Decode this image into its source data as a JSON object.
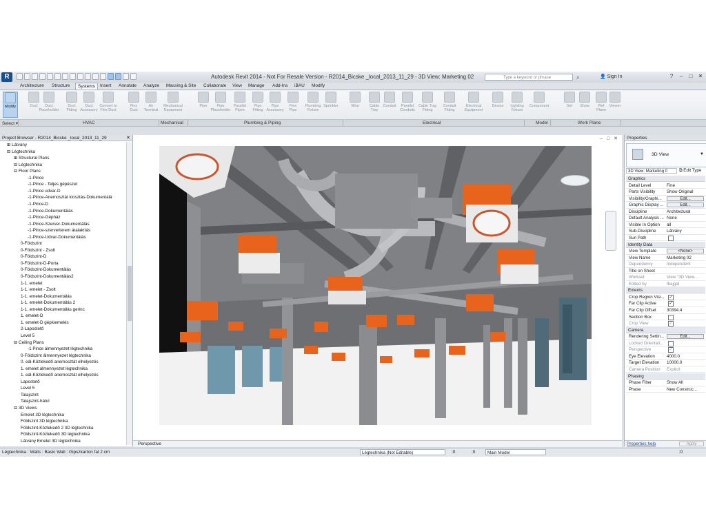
{
  "window": {
    "title": "Autodesk Revit 2014 - Not For Resale Version -    R2014_Bicske _local_2013_11_29 - 3D View: Marketing 02",
    "search_placeholder": "Type a keyword or phrase",
    "sign_in": "Sign In"
  },
  "tabs": [
    "Architecture",
    "Structure",
    "Systems",
    "Insert",
    "Annotate",
    "Analyze",
    "Massing & Site",
    "Collaborate",
    "View",
    "Manage",
    "Add-Ins",
    "iBAU",
    "Modify"
  ],
  "active_tab": "Systems",
  "ribbon": {
    "buttons": [
      {
        "label": "Modify",
        "l2": ""
      },
      {
        "label": "Duct",
        "l2": ""
      },
      {
        "label": "Duct",
        "l2": "Placeholder"
      },
      {
        "label": "Duct",
        "l2": "Fitting"
      },
      {
        "label": "Duct",
        "l2": "Accessory"
      },
      {
        "label": "Convert to",
        "l2": "Flex Duct"
      },
      {
        "label": "Flex",
        "l2": "Duct"
      },
      {
        "label": "Air",
        "l2": "Terminal"
      },
      {
        "label": "Mechanical",
        "l2": "Equipment"
      },
      {
        "label": "Pipe",
        "l2": ""
      },
      {
        "label": "Pipe",
        "l2": "Placeholder"
      },
      {
        "label": "Parallel",
        "l2": "Pipes"
      },
      {
        "label": "Pipe",
        "l2": "Fitting"
      },
      {
        "label": "Pipe",
        "l2": "Accessory"
      },
      {
        "label": "Flex",
        "l2": "Pipe"
      },
      {
        "label": "Plumbing",
        "l2": "Fixture"
      },
      {
        "label": "Sprinkler",
        "l2": ""
      },
      {
        "label": "Wire",
        "l2": ""
      },
      {
        "label": "Cable",
        "l2": "Tray"
      },
      {
        "label": "Conduit",
        "l2": ""
      },
      {
        "label": "Parallel",
        "l2": "Conduits"
      },
      {
        "label": "Cable Tray",
        "l2": "Fitting"
      },
      {
        "label": "Conduit",
        "l2": "Fitting"
      },
      {
        "label": "Electrical",
        "l2": "Equipment"
      },
      {
        "label": "Device",
        "l2": ""
      },
      {
        "label": "Lighting",
        "l2": "Fixture"
      },
      {
        "label": "Component",
        "l2": ""
      },
      {
        "label": "Set",
        "l2": ""
      },
      {
        "label": "Show",
        "l2": ""
      },
      {
        "label": "Ref",
        "l2": "Plane"
      },
      {
        "label": "Viewer",
        "l2": ""
      }
    ],
    "panels": [
      "Select ▾",
      "HVAC",
      "Mechanical",
      "Plumbing & Piping",
      "Electrical",
      "Model",
      "Work Plane"
    ]
  },
  "project_browser": {
    "title": "Project Browser - R2014_Bicske _local_2013_11_29",
    "items": [
      {
        "t": "Látvány",
        "d": 2,
        "e": "+"
      },
      {
        "t": "Légtechnika",
        "d": 2,
        "e": "-"
      },
      {
        "t": "Structural Plans",
        "d": 3,
        "e": "+"
      },
      {
        "t": "Légtechnika",
        "d": 3,
        "e": "-"
      },
      {
        "t": "Floor Plans",
        "d": 3,
        "e": "-"
      },
      {
        "t": "-1-Pince",
        "d": 5,
        "e": ""
      },
      {
        "t": "-1-Pince - Teljes gépészet",
        "d": 5,
        "e": ""
      },
      {
        "t": "-1-Pince udvar-D",
        "d": 5,
        "e": ""
      },
      {
        "t": "-1-Pince-Anemosztát kiosztás-Dokumentálá",
        "d": 5,
        "e": ""
      },
      {
        "t": "-1-Pince-D",
        "d": 5,
        "e": ""
      },
      {
        "t": "-1-Pince-Dokumentálás",
        "d": 5,
        "e": ""
      },
      {
        "t": "-1-Pince-Gépház",
        "d": 5,
        "e": ""
      },
      {
        "t": "-1-Pince-Szerver-Dokumentálás",
        "d": 5,
        "e": ""
      },
      {
        "t": "-1-Pince-szerverterem átalakítás",
        "d": 5,
        "e": ""
      },
      {
        "t": "-1-Pince-Udvar-Dokumentálás",
        "d": 5,
        "e": ""
      },
      {
        "t": "0-Földszint",
        "d": 4,
        "e": ""
      },
      {
        "t": "0-Földszint - Zsolt",
        "d": 4,
        "e": ""
      },
      {
        "t": "0-Földszint-D",
        "d": 4,
        "e": ""
      },
      {
        "t": "0-Földszint-D-Porta",
        "d": 4,
        "e": ""
      },
      {
        "t": "0-Földszint-Dokumentálás",
        "d": 4,
        "e": ""
      },
      {
        "t": "0-Földszint-Dokumentálás2",
        "d": 4,
        "e": ""
      },
      {
        "t": "1-1. emelet",
        "d": 4,
        "e": ""
      },
      {
        "t": "1-1. emelet - Zsolt",
        "d": 4,
        "e": ""
      },
      {
        "t": "1-1. emelet-Dokumentálás",
        "d": 4,
        "e": ""
      },
      {
        "t": "1-1. emelet-Dokumentálás 2",
        "d": 4,
        "e": ""
      },
      {
        "t": "1-1. emelet-Dokumentálás gerinc",
        "d": 4,
        "e": ""
      },
      {
        "t": "1. emelet-D",
        "d": 4,
        "e": ""
      },
      {
        "t": "1. emelet-D gépkiemelés",
        "d": 4,
        "e": ""
      },
      {
        "t": "2-Lapostető",
        "d": 4,
        "e": ""
      },
      {
        "t": "Level 5",
        "d": 4,
        "e": ""
      },
      {
        "t": "Ceiling Plans",
        "d": 3,
        "e": "-"
      },
      {
        "t": "-1 Pince álmennyezet légtechnika",
        "d": 5,
        "e": ""
      },
      {
        "t": "0-Földszint álmennyezet légtechnika",
        "d": 4,
        "e": ""
      },
      {
        "t": "0. eál-Közlekedő anemosztát elhelyezés",
        "d": 4,
        "e": ""
      },
      {
        "t": "1. emelet álmennyezet légtechnika",
        "d": 4,
        "e": ""
      },
      {
        "t": "1. eál-Közlekedő anemosztát elhelyezés",
        "d": 4,
        "e": ""
      },
      {
        "t": "Lapostető",
        "d": 4,
        "e": ""
      },
      {
        "t": "Level 5",
        "d": 4,
        "e": ""
      },
      {
        "t": "Talajszint",
        "d": 4,
        "e": ""
      },
      {
        "t": "Talajszint-hátul",
        "d": 4,
        "e": ""
      },
      {
        "t": "3D Views",
        "d": 3,
        "e": "-"
      },
      {
        "t": "Emelet 3D légtechnika",
        "d": 4,
        "e": ""
      },
      {
        "t": "Földszint 3D légtechnika",
        "d": 4,
        "e": ""
      },
      {
        "t": "Földszint-Közlekedő 2 3D légtechnika",
        "d": 4,
        "e": ""
      },
      {
        "t": "Földszint-Közlekedő 3D légtechnika",
        "d": 4,
        "e": ""
      },
      {
        "t": "Látvány Emelet 3D légtechnika",
        "d": 4,
        "e": ""
      }
    ]
  },
  "viewport": {
    "mode": "Perspective"
  },
  "properties": {
    "title": "Properties",
    "type_name": "3D View",
    "instance": "3D View: Marketing 0",
    "edit_type": "Edit Type",
    "rows": [
      {
        "g": "Graphics"
      },
      {
        "k": "Detail Level",
        "v": "Fine"
      },
      {
        "k": "Parts Visibility",
        "v": "Show Original"
      },
      {
        "k": "Visibility/Graphi...",
        "b": "Edit..."
      },
      {
        "k": "Graphic Display ...",
        "b": "Edit..."
      },
      {
        "k": "Discipline",
        "v": "Architectural"
      },
      {
        "k": "Default Analysis ...",
        "v": "None"
      },
      {
        "k": "Visible In Option",
        "v": "all"
      },
      {
        "k": "Sub-Discipline",
        "v": "Látvány"
      },
      {
        "k": "Sun Path",
        "c": ""
      },
      {
        "g": "Identity Data"
      },
      {
        "k": "View Template",
        "b": "<None>"
      },
      {
        "k": "View Name",
        "v": "Marketing 02"
      },
      {
        "k": "Dependency",
        "v": "Independent",
        "dim": true
      },
      {
        "k": "Title on Sheet",
        "v": ""
      },
      {
        "k": "Workset",
        "v": "View \"3D View...",
        "dim": true
      },
      {
        "k": "Edited by",
        "v": "fbajgal",
        "dim": true
      },
      {
        "g": "Extents"
      },
      {
        "k": "Crop Region Visi...",
        "c": "✓"
      },
      {
        "k": "Far Clip Active",
        "c": "✓"
      },
      {
        "k": "Far Clip Offset",
        "v": "30394.4"
      },
      {
        "k": "Section Box",
        "c": ""
      },
      {
        "k": "Crop View",
        "c": "✓",
        "dim": true
      },
      {
        "g": "Camera"
      },
      {
        "k": "Rendering Settin...",
        "b": "Edit..."
      },
      {
        "k": "Locked Orientati...",
        "c": "",
        "dim": true
      },
      {
        "k": "Perspective",
        "c": "✓",
        "dim": true
      },
      {
        "k": "Eye Elevation",
        "v": "4000.0"
      },
      {
        "k": "Target Elevation",
        "v": "10000.0"
      },
      {
        "k": "Camera Position",
        "v": "Explicit",
        "dim": true
      },
      {
        "g": "Phasing"
      },
      {
        "k": "Phase Filter",
        "v": "Show All"
      },
      {
        "k": "Phase",
        "v": "New Construc..."
      }
    ],
    "help": "Properties help",
    "apply": "Apply"
  },
  "status": {
    "text": "Légtechnika : Walls : Basic Wall : Gipszkarton fal 2 cm",
    "workset": "Légtechnika (Not Editable)",
    "zero1": ":0",
    "zero2": ":0",
    "model": "Main Model",
    "zero3": ":0"
  }
}
